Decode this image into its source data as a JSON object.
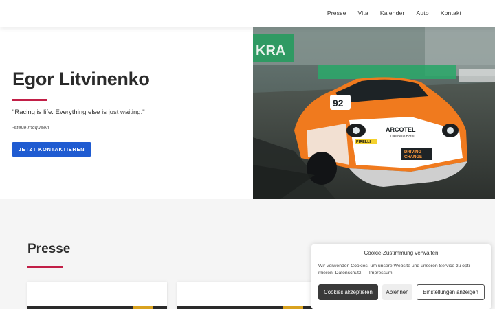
{
  "nav": {
    "items": [
      "Presse",
      "Vita",
      "Kalender",
      "Auto",
      "Kontakt"
    ]
  },
  "hero": {
    "name": "Egor Litvinenko",
    "quote": "\"Racing is life. Everything else is just waiting.\"",
    "quote_author": "-steve mcqueen",
    "cta_label": "JETZT KONTAKTIEREN",
    "photo": {
      "car_number": "92",
      "sponsor_1": "ARCOTEL",
      "sponsor_1_sub": "Das neue Hotel",
      "sponsor_2": "PIRELLI",
      "plate_top": "DRIVING",
      "plate_bottom": "CHANGE",
      "banner": "KRA"
    }
  },
  "presse": {
    "title": "Presse"
  },
  "cookie": {
    "title": "Cookie-Zustimmung verwalten",
    "text": "Wir verwenden Cookies, um unsere Website und unseren Service zu opti-mieren.",
    "link_privacy": "Datenschutz",
    "separator": "–",
    "link_imprint": "Impressum",
    "accept_label": "Cookies akzeptieren",
    "deny_label": "Ablehnen",
    "settings_label": "Einstellungen anzeigen"
  },
  "colors": {
    "accent": "#c21f47",
    "cta": "#1f5bd1",
    "car_orange": "#f07a1e"
  }
}
